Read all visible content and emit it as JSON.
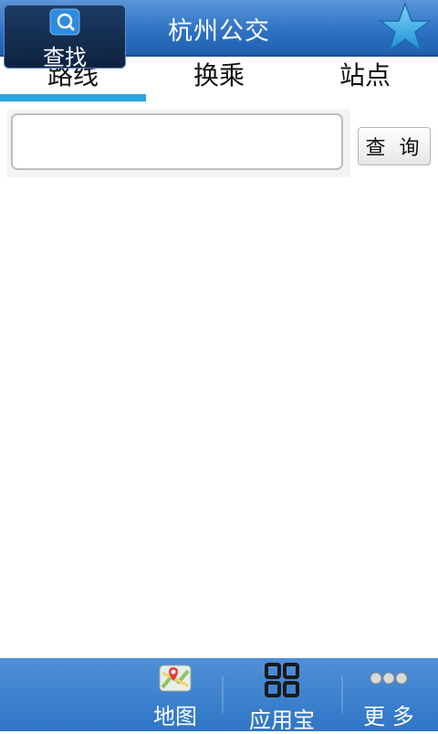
{
  "header": {
    "title": "杭州公交",
    "favorite_icon": "star-icon"
  },
  "tabs": [
    {
      "label": "路线",
      "active": true
    },
    {
      "label": "换乘",
      "active": false
    },
    {
      "label": "站点",
      "active": false
    }
  ],
  "search": {
    "value": "",
    "placeholder": "",
    "button_label": "查 询"
  },
  "bottom_nav": [
    {
      "label": "查找",
      "icon": "search-icon",
      "active": true
    },
    {
      "label": "地图",
      "icon": "map-icon",
      "active": false
    },
    {
      "label": "应用宝",
      "icon": "grid-icon",
      "active": false
    },
    {
      "label": "更 多",
      "icon": "more-icon",
      "active": false
    }
  ],
  "colors": {
    "header_blue": "#2f73c4",
    "tab_indicator": "#27a6e0",
    "nav_active": "#0d223f"
  }
}
